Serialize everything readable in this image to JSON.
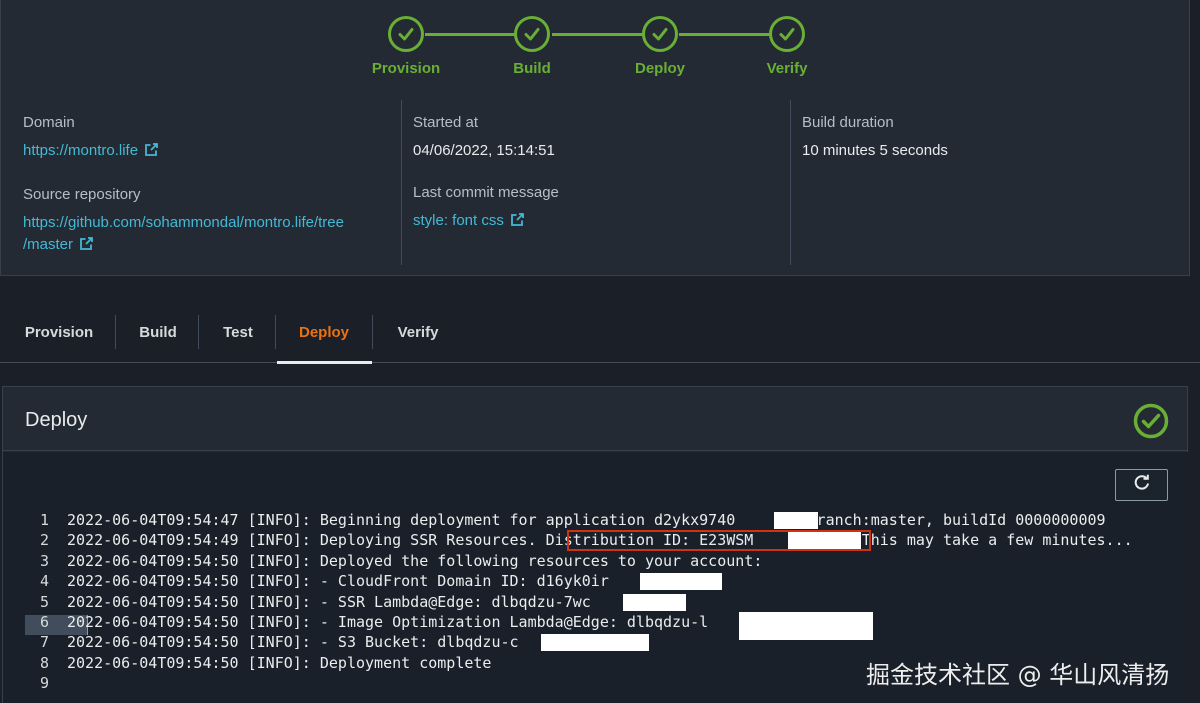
{
  "stepper": {
    "steps": [
      "Provision",
      "Build",
      "Deploy",
      "Verify"
    ],
    "status_color": "#6aaf35"
  },
  "summary": {
    "domain_label": "Domain",
    "domain_value": "https://montro.life",
    "source_label": "Source repository",
    "source_value_1": "https://github.com/sohammondal/montro.life/tree",
    "source_value_2": "/master",
    "started_label": "Started at",
    "started_value": "04/06/2022, 15:14:51",
    "commit_label": "Last commit message",
    "commit_value": "style: font css",
    "duration_label": "Build duration",
    "duration_value": "10 minutes 5 seconds"
  },
  "tabs": {
    "items": [
      "Provision",
      "Build",
      "Test",
      "Deploy",
      "Verify"
    ],
    "active": "Deploy",
    "active_color": "#ec7211"
  },
  "deploy": {
    "title": "Deploy",
    "refresh_icon": "refresh-icon",
    "log_lines": [
      {
        "n": "1",
        "text": "2022-06-04T09:54:47 [INFO]: Beginning deployment for application d2ykx9740      , branch:master, buildId 0000000009"
      },
      {
        "n": "2",
        "text": "2022-06-04T09:54:49 [INFO]: Deploying SSR Resources. Distribution ID: E23WSM         I. This may take a few minutes..."
      },
      {
        "n": "3",
        "text": "2022-06-04T09:54:50 [INFO]: Deployed the following resources to your account:"
      },
      {
        "n": "4",
        "text": "2022-06-04T09:54:50 [INFO]: - CloudFront Domain ID: d16yk0ir"
      },
      {
        "n": "5",
        "text": "2022-06-04T09:54:50 [INFO]: - SSR Lambda@Edge: dlbqdzu-7wc"
      },
      {
        "n": "6",
        "text": "2022-06-04T09:54:50 [INFO]: - Image Optimization Lambda@Edge: dlbqdzu-l"
      },
      {
        "n": "7",
        "text": "2022-06-04T09:54:50 [INFO]: - S3 Bucket: dlbqdzu-c"
      },
      {
        "n": "8",
        "text": "2022-06-04T09:54:50 [INFO]: Deployment complete"
      },
      {
        "n": "9",
        "text": ""
      }
    ]
  },
  "watermark": "掘金技术社区 @ 华山风清扬"
}
